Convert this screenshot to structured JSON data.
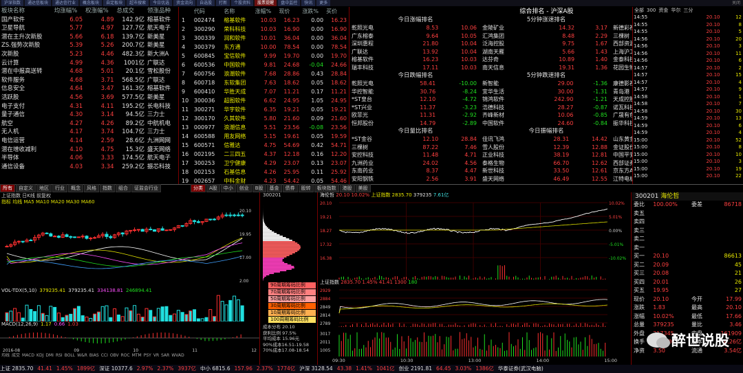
{
  "tabs": [
    "沪深指数",
    "通达信板块",
    "通达信行业",
    "概念板块",
    "自定板块",
    "超市搜索",
    "今日优选",
    "资金流向",
    "自选股",
    "打新",
    "个股资料",
    "股票提醒",
    "盘中监控",
    "快讯",
    "更多"
  ],
  "active_tab": "股票提醒",
  "window_label": "关闭",
  "sectors": {
    "headers": [
      "板块名称",
      "均涨幅%",
      "权涨幅%",
      "总成交",
      "领涨品种"
    ],
    "rows": [
      [
        "国产软件",
        "6.05",
        "4.89",
        "142.9亿",
        "榕基软件"
      ],
      [
        "卫星导航",
        "5.77",
        "4.97",
        "127.7亿",
        "航天电子"
      ],
      [
        "潜在主升次新股",
        "5.66",
        "6.18",
        "139.7亿",
        "新美星"
      ],
      [
        "ZS.强势次新股",
        "5.39",
        "5.26",
        "200.7亿",
        "新美星"
      ],
      [
        "次新股",
        "5.23",
        "4.46",
        "482.3亿",
        "新大洲A"
      ],
      [
        "云计算",
        "4.99",
        "4.36",
        "1001亿",
        "广联达"
      ],
      [
        "潜在中报高送转",
        "4.68",
        "5.01",
        "20.1亿",
        "雪松股份"
      ],
      [
        "软件服务",
        "4.68",
        "3.71",
        "568.5亿",
        "广联达"
      ],
      [
        "信息安全",
        "4.64",
        "3.47",
        "161.3亿",
        "榕基软件"
      ],
      [
        "活跃股",
        "4.56",
        "3.69",
        "577.5亿",
        "新美星"
      ],
      [
        "电子支付",
        "4.31",
        "4.11",
        "195.2亿",
        "长电科技"
      ],
      [
        "量子通信",
        "4.30",
        "3.14",
        "94.5亿",
        "三力士"
      ],
      [
        "航空",
        "4.27",
        "4.26",
        "89.2亿",
        "中航机电"
      ],
      [
        "无人机",
        "4.17",
        "3.74",
        "104.7亿",
        "三力士"
      ],
      [
        "电信运营",
        "4.14",
        "2.59",
        "28.6亿",
        "九洲网网"
      ],
      [
        "潜在增收减利",
        "4.10",
        "4.75",
        "15.3亿",
        "盛天网络"
      ],
      [
        "半导体",
        "4.06",
        "3.33",
        "174.5亿",
        "航天电子"
      ],
      [
        "通信设备",
        "4.03",
        "3.34",
        "259.2亿",
        "振芯科技"
      ]
    ]
  },
  "stocks": {
    "headers": [
      "代码",
      "名称",
      "涨幅%",
      "现价",
      "涨跌%",
      "买价"
    ],
    "rows": [
      [
        "1",
        "002474",
        "榕基软件",
        "10.03",
        "16.23",
        "0.00",
        "16.23"
      ],
      [
        "2",
        "300290",
        "荣科科技",
        "10.03",
        "16.90",
        "0.00",
        "16.90"
      ],
      [
        "3",
        "300339",
        "润和软件",
        "10.01",
        "36.04",
        "0.00",
        "36.04"
      ],
      [
        "4",
        "300379",
        "东方通",
        "10.00",
        "78.54",
        "0.00",
        "78.54"
      ],
      [
        "5",
        "600845",
        "宝信软件",
        "9.99",
        "19.70",
        "0.00",
        "19.70"
      ],
      [
        "6",
        "600536",
        "中国软件",
        "9.81",
        "24.68",
        "-0.04",
        "24.66"
      ],
      [
        "7",
        "600756",
        "浪潮软件",
        "7.68",
        "28.86",
        "0.43",
        "28.84"
      ],
      [
        "8",
        "600718",
        "东软集团",
        "7.63",
        "18.62",
        "0.05",
        "18.62"
      ],
      [
        "9",
        "600410",
        "华胜天成",
        "7.07",
        "11.21",
        "0.17",
        "11.21"
      ],
      [
        "10",
        "300036",
        "超图软件",
        "6.62",
        "24.95",
        "1.05",
        "24.95"
      ],
      [
        "11",
        "300271",
        "华宇软件",
        "6.35",
        "19.21",
        "0.05",
        "19.21"
      ],
      [
        "12",
        "300170",
        "久其软件",
        "5.80",
        "21.60",
        "0.09",
        "21.60"
      ],
      [
        "13",
        "000977",
        "浪潮信息",
        "5.51",
        "23.56",
        "-0.08",
        "23.56"
      ],
      [
        "14",
        "600588",
        "用友网络",
        "5.15",
        "19.61",
        "0.05",
        "19.59"
      ],
      [
        "15",
        "600571",
        "信雅达",
        "4.75",
        "54.69",
        "0.42",
        "54.71"
      ],
      [
        "16",
        "002195",
        "二三四五",
        "4.37",
        "12.18",
        "0.16",
        "12.20"
      ],
      [
        "17",
        "300253",
        "卫宁健康",
        "4.29",
        "23.07",
        "0.13",
        "23.07"
      ],
      [
        "18",
        "002153",
        "石基信息",
        "4.26",
        "25.95",
        "0.11",
        "25.92"
      ],
      [
        "19",
        "002657",
        "中科金财",
        "4.23",
        "54.42",
        "0.05",
        "54.46"
      ]
    ]
  },
  "rank_title": "综合排名 - 沪深A股",
  "ranks": [
    {
      "title": "今日涨幅排名",
      "rows": [
        [
          "乾照光电",
          "8.53",
          "10.06"
        ],
        [
          "广东榕泰",
          "9.64",
          "10.05"
        ],
        [
          "深圳惠程",
          "21.80",
          "10.04"
        ],
        [
          "广联达",
          "13.92",
          "10.04"
        ],
        [
          "榕基软件",
          "16.23",
          "10.03"
        ],
        [
          "瑞丰科技",
          "17.11",
          "10.03"
        ]
      ]
    },
    {
      "title": "5分钟涨速排名",
      "rows": [
        [
          "金陵矿业",
          "14.32",
          "3.17"
        ],
        [
          "汇鸿集团",
          "8.48",
          "2.29"
        ],
        [
          "泛海控股",
          "9.75",
          "1.67"
        ],
        [
          "湖南天雁",
          "5.66",
          "1.43"
        ],
        [
          "达芬奇",
          "10.89",
          "1.40"
        ],
        [
          "南天信息",
          "19.31",
          "1.36"
        ]
      ]
    },
    {
      "title": "今日委比前排名",
      "rows": [
        [
          "新德彩视",
          "13.70",
          "100.00"
        ],
        [
          "三棵树",
          "76.63",
          "100.00"
        ],
        [
          "西部资源",
          "13.59",
          "100.00"
        ],
        [
          "上海沪工",
          "45.60",
          "100.00"
        ],
        [
          "金泰科技",
          "13.90",
          "100.00"
        ],
        [
          "花园生物",
          "32.85",
          "100.00"
        ]
      ]
    },
    {
      "title": "今日跌幅排名",
      "rows": [
        [
          "乾照光电",
          "58.41",
          "-10.00"
        ],
        [
          "华控智能",
          "30.76",
          "-8.24"
        ],
        [
          "*ST皇台",
          "12.10",
          "-4.72"
        ],
        [
          "*ST兴业",
          "11.37",
          "-3.23"
        ],
        [
          "欧菲光",
          "11.31",
          "-2.92"
        ],
        [
          "恒邦股份",
          "14.79",
          "-2.89"
        ]
      ]
    },
    {
      "title": "5分钟跌速排名",
      "rows": [
        [
          "新智能",
          "29.00",
          "-1.36"
        ],
        [
          "宜华生活",
          "30.00",
          "-1.31"
        ],
        [
          "锦鸿软件",
          "242.90",
          "-1.21"
        ],
        [
          "浩德科技",
          "28.27",
          "-0.87"
        ],
        [
          "齐峰新材",
          "10.06",
          "-0.85"
        ],
        [
          "中国软件",
          "24.60",
          "-0.84"
        ]
      ]
    },
    {
      "title": "今日委比后排名",
      "rows": [
        [
          "康德影视",
          "11.62",
          "-99.29"
        ],
        [
          "青岛港",
          "10.46",
          "-99.10"
        ],
        [
          "天成控股",
          "21.00",
          "-96.54"
        ],
        [
          "诺瓦科技",
          "36.52",
          "-95.98"
        ],
        [
          "广晟有色",
          "55.95",
          "-94.34"
        ],
        [
          "振华科技",
          "15.77",
          "-93.67"
        ]
      ]
    },
    {
      "title": "今日量比排名",
      "rows": [
        [
          "*ST金谷",
          "12.10",
          "28.84"
        ],
        [
          "三棵树",
          "87.22",
          "7.46"
        ],
        [
          "安控科技",
          "11.48",
          "4.71"
        ],
        [
          "九洲药业",
          "24.02",
          "4.56"
        ],
        [
          "东南药业",
          "8.37",
          "4.47"
        ],
        [
          "安阳钢铁",
          "2.56",
          "3.91"
        ]
      ]
    },
    {
      "title": "今日振幅排名",
      "rows": [
        [
          "佳讯飞鸿",
          "28.31",
          "14.42"
        ],
        [
          "雪人股份",
          "12.39",
          "12.88"
        ],
        [
          "正业科技",
          "38.19",
          "12.81"
        ],
        [
          "泰格生物",
          "66.70",
          "12.62"
        ],
        [
          "新世科技",
          "33.50",
          "12.61"
        ],
        [
          "盛天网络",
          "46.49",
          "12.55"
        ]
      ]
    },
    {
      "title": "今日总金额排名",
      "rows": [
        [
          "山东黄金",
          "33.96",
          "31.0亿"
        ],
        [
          "金证股份",
          "30.02",
          "24.1亿"
        ],
        [
          "中国平安",
          "35.15",
          "23.9亿"
        ],
        [
          "西部证券",
          "24.52",
          "19.6亿"
        ],
        [
          "京东方A",
          "4.51",
          "18.6亿"
        ],
        [
          "江特电机",
          "16.00",
          "17.1亿"
        ]
      ]
    }
  ],
  "left_buttons": [
    "所有",
    "自定义",
    "地区",
    "行业",
    "概念",
    "风格",
    "指数",
    "组合",
    "证监会行业"
  ],
  "mid_buttons": [
    "分类",
    "A股",
    "中小",
    "创业",
    "B股",
    "基金",
    "债券",
    "股转",
    "板块指数",
    "港股",
    "美股"
  ],
  "kline": {
    "title": "上证指数",
    "info": "日K线 前复权",
    "price_labels": [
      "20.10",
      "19.95",
      "17.00",
      "2.00"
    ],
    "labels": [
      "1.47",
      "20.10",
      "15.55-17.00"
    ]
  },
  "kline_legend": "指标 均线 MA5 MA10 MA20 MA30 MA60",
  "vol_legend": {
    "name": "VOL-TDX(5,10)",
    "vol": "379235.41",
    "v5": "379235.41",
    "v10": "334138.81",
    "v20": "246894.41"
  },
  "macd_legend": {
    "name": "MACD(12,26,9)",
    "dif": "1.17",
    "dea": "0.66",
    "macd": "1.03"
  },
  "kline_dates": [
    "2016-08",
    "09",
    "10",
    "11",
    "12"
  ],
  "kline_indicators": [
    "均线",
    "成交",
    "MACD",
    "KDJ",
    "DMI",
    "RSI",
    "BOLL",
    "W&R",
    "BIAS",
    "CCI",
    "OBV",
    "ROC",
    "MTM",
    "PSY",
    "VR",
    "SAR",
    "WVAD"
  ],
  "chip": {
    "code": "300201",
    "bars": [
      "90周期筹码比例",
      "70周期筹码比例",
      "50周期筹码比例",
      "30周期筹码比例",
      "10周期筹码比例",
      "100周期筹码比例"
    ],
    "colors": [
      "#ff6060",
      "#ff8080",
      "#ffa0a0",
      "#ff6000",
      "#ffb050",
      "#ffe060"
    ],
    "info": [
      "成本分布 20.10",
      "获利比例 97.5%",
      "平均成本 15.96元",
      "90%成本16.51-19.58",
      "70%成本17.08-18.54"
    ]
  },
  "intraday": {
    "title": "海伦哲",
    "price": "20.10",
    "change": "10.02%",
    "vol": "379235",
    "amount": "7.61亿",
    "hs_label": "上证指数 2835.70",
    "time_labels": [
      "09:30",
      "10:30",
      "13:00",
      "14:00",
      "15:00"
    ],
    "y_labels": [
      "20.10",
      "19.21",
      "18.27",
      "17.32",
      "16.38"
    ],
    "vol_labels": [
      "34078",
      "22719",
      "11359"
    ],
    "pct_labels": [
      "10.02%",
      "5.01%",
      "0.00%",
      "-5.01%",
      "-10.02%"
    ]
  },
  "index_intraday": {
    "title": "上证指数",
    "value": "2835.70",
    "change": "1.45%",
    "change_pts": "41.41",
    "upcount": "1300",
    "downcount": "180",
    "y_labels": [
      "2929",
      "2884",
      "2849",
      "2814",
      "2789"
    ],
    "vol_labels": [
      "3017",
      "2011",
      "1005"
    ]
  },
  "quote": {
    "code": "300201",
    "name": "海伦哲",
    "wb_label": "委比",
    "wb": "100.00%",
    "wc_label": "委差",
    "wc": "86718",
    "sells": [
      [
        "卖五",
        ""
      ],
      [
        "卖四",
        ""
      ],
      [
        "卖三",
        ""
      ],
      [
        "卖二",
        ""
      ],
      [
        "卖一",
        ""
      ]
    ],
    "buys": [
      [
        "买一",
        "20.10",
        "86613"
      ],
      [
        "买二",
        "20.09",
        "45"
      ],
      [
        "买三",
        "20.08",
        "21"
      ],
      [
        "买四",
        "20.01",
        "26"
      ],
      [
        "买五",
        "19.95",
        "27"
      ]
    ],
    "stats": [
      [
        "现价",
        "20.10",
        "今开",
        "17.99"
      ],
      [
        "涨跌",
        "1.83",
        "最高",
        "20.10"
      ],
      [
        "涨幅",
        "10.02%",
        "最低",
        "17.66"
      ],
      [
        "总量",
        "379235",
        "量比",
        "3.46"
      ],
      [
        "外盘",
        "217345",
        "内盘",
        "161909"
      ],
      [
        "换手",
        "10.71%",
        "股本",
        "4.26亿"
      ],
      [
        "净资",
        "3.50",
        "流通",
        "3.54亿"
      ]
    ]
  },
  "ticks": [
    [
      "14:55",
      "20.10",
      "12"
    ],
    [
      "14:55",
      "20.10",
      "8"
    ],
    [
      "14:55",
      "20.10",
      "5"
    ],
    [
      "14:56",
      "20.10",
      "20"
    ],
    [
      "14:56",
      "20.10",
      "3"
    ],
    [
      "14:56",
      "20.10",
      "11"
    ],
    [
      "14:56",
      "20.10",
      "6"
    ],
    [
      "14:57",
      "20.10",
      "2"
    ],
    [
      "14:57",
      "20.10",
      "15"
    ],
    [
      "14:57",
      "20.10",
      "4"
    ],
    [
      "14:57",
      "20.10",
      "9"
    ],
    [
      "14:58",
      "20.10",
      "1"
    ],
    [
      "14:58",
      "20.10",
      "7"
    ],
    [
      "14:58",
      "20.10",
      "30"
    ],
    [
      "14:59",
      "20.10",
      "13"
    ],
    [
      "14:59",
      "20.10",
      "6"
    ],
    [
      "14:59",
      "20.10",
      "4"
    ],
    [
      "15:00",
      "20.10",
      "52"
    ],
    [
      "15:00",
      "20.10",
      "8"
    ],
    [
      "15:00",
      "20.10",
      "10"
    ],
    [
      "15:00",
      "20.10",
      "3"
    ],
    [
      "15:00",
      "20.10",
      "19"
    ],
    [
      "15:00",
      "20.10",
      "22"
    ],
    [
      "15:00",
      "20.10",
      "5"
    ],
    [
      "15:00",
      "20.10",
      "14"
    ],
    [
      "15:00",
      "20.10",
      "2"
    ]
  ],
  "tick_header": [
    "全部",
    "300",
    "资金",
    "华尔",
    "三分"
  ],
  "status": [
    "上证 2835.70",
    "41.41",
    "1.45%",
    "1899亿",
    "深证 10377.6",
    "2.97%",
    "2.37%",
    "3937亿",
    "中小 6815.6",
    "157.96",
    "2.37%",
    "1774亿",
    "沪深 3128.54",
    "43.38",
    "1.41%",
    "1041亿",
    "创业 2191.81",
    "64.45",
    "3.03%",
    "1386亿",
    "华泰证券(武汉电脑)"
  ],
  "watermark": "醉世说股"
}
